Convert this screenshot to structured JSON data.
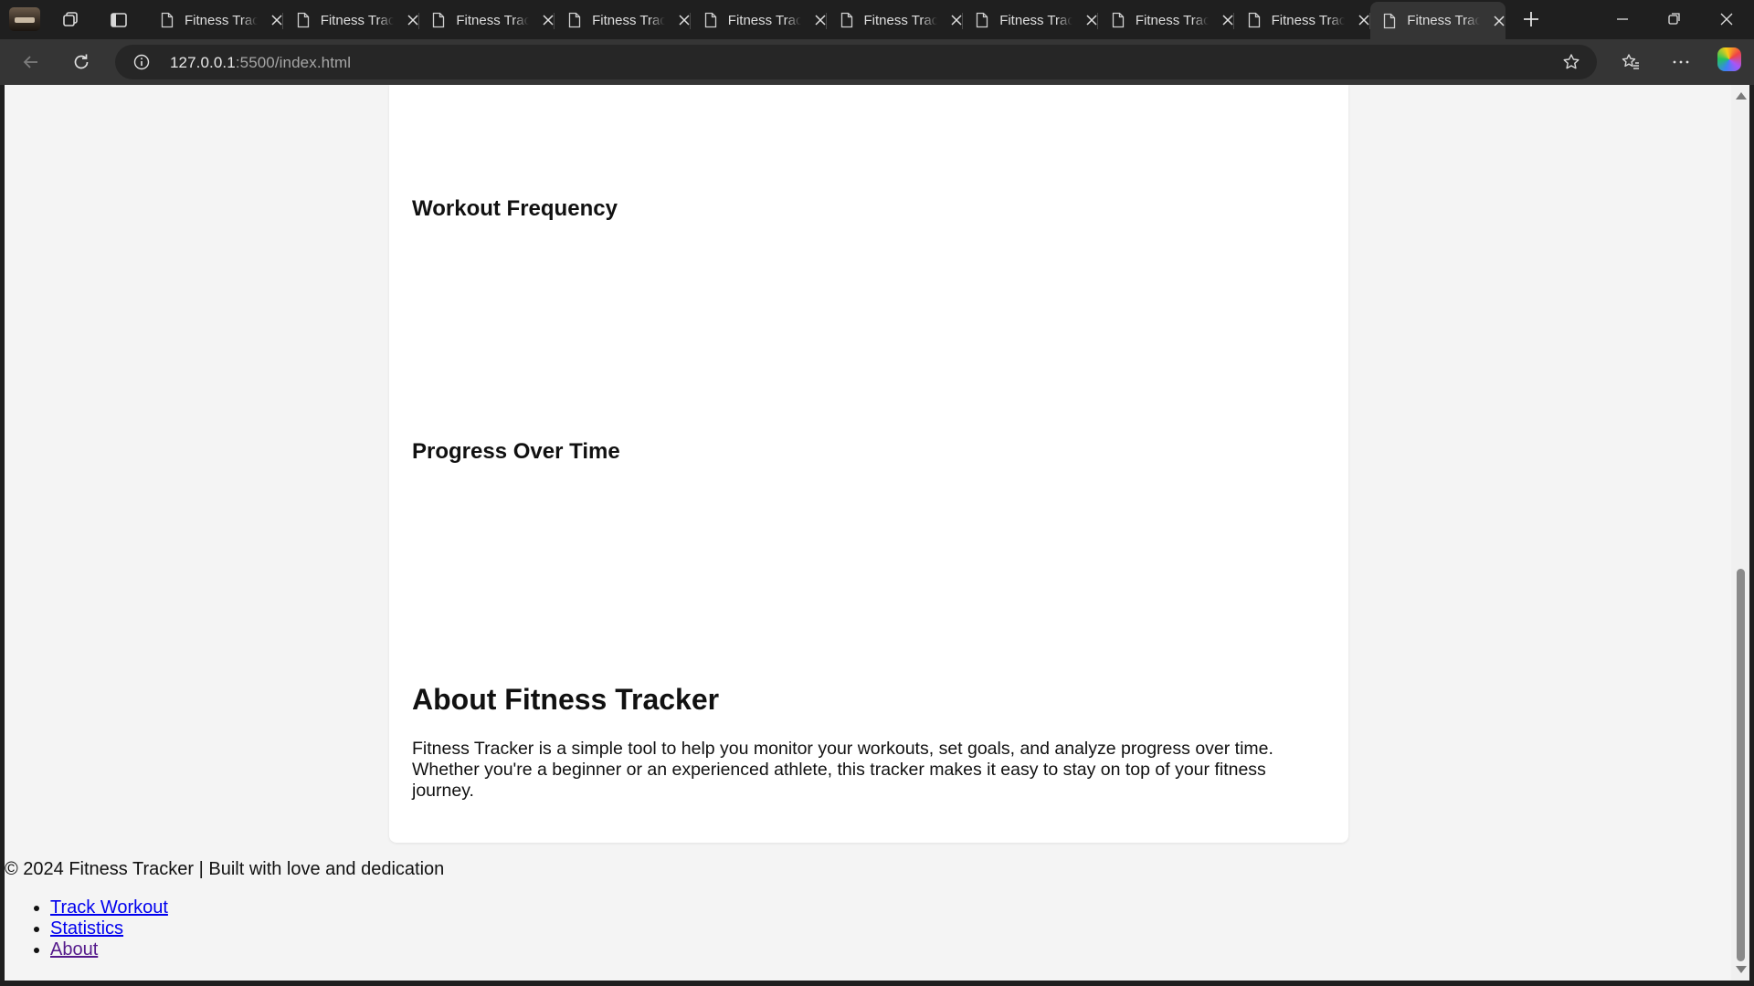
{
  "browser": {
    "tabs": [
      {
        "title": "Fitness Tracker",
        "active": false
      },
      {
        "title": "Fitness Tracker",
        "active": false
      },
      {
        "title": "Fitness Tracker",
        "active": false
      },
      {
        "title": "Fitness Tracker",
        "active": false
      },
      {
        "title": "Fitness Tracker",
        "active": false
      },
      {
        "title": "Fitness Tracker",
        "active": false
      },
      {
        "title": "Fitness Tracker",
        "active": false
      },
      {
        "title": "Fitness Tracker",
        "active": false
      },
      {
        "title": "Fitness Tracker",
        "active": false
      },
      {
        "title": "Fitness Tracker",
        "active": true
      }
    ],
    "url_host": "127.0.0.1",
    "url_rest": ":5500/index.html",
    "icons": [
      "profile-avatar",
      "workspaces-icon",
      "vertical-tabs-icon",
      "page-icon",
      "close-icon",
      "new-tab-icon",
      "minimize-icon",
      "restore-icon",
      "close-window-icon",
      "back-icon",
      "refresh-icon",
      "site-info-icon",
      "favorite-star-icon",
      "favorites-icon",
      "more-icon",
      "copilot-icon"
    ]
  },
  "page": {
    "workout_frequency_heading": "Workout Frequency",
    "progress_heading": "Progress Over Time",
    "about_heading": "About Fitness Tracker",
    "about_text": "Fitness Tracker is a simple tool to help you monitor your workouts, set goals, and analyze progress over time. Whether you're a beginner or an experienced athlete, this tracker makes it easy to stay on top of your fitness journey.",
    "footer_text": "© 2024 Fitness Tracker | Built with love and dedication",
    "footer_links": [
      "Track Workout",
      "Statistics",
      "About"
    ]
  },
  "colors": {
    "page_background": "#f4f4f4",
    "card_background": "#ffffff",
    "link": "#0000ee",
    "visited_link": "#551a8b",
    "browser_chrome": "#1f1f1f"
  }
}
